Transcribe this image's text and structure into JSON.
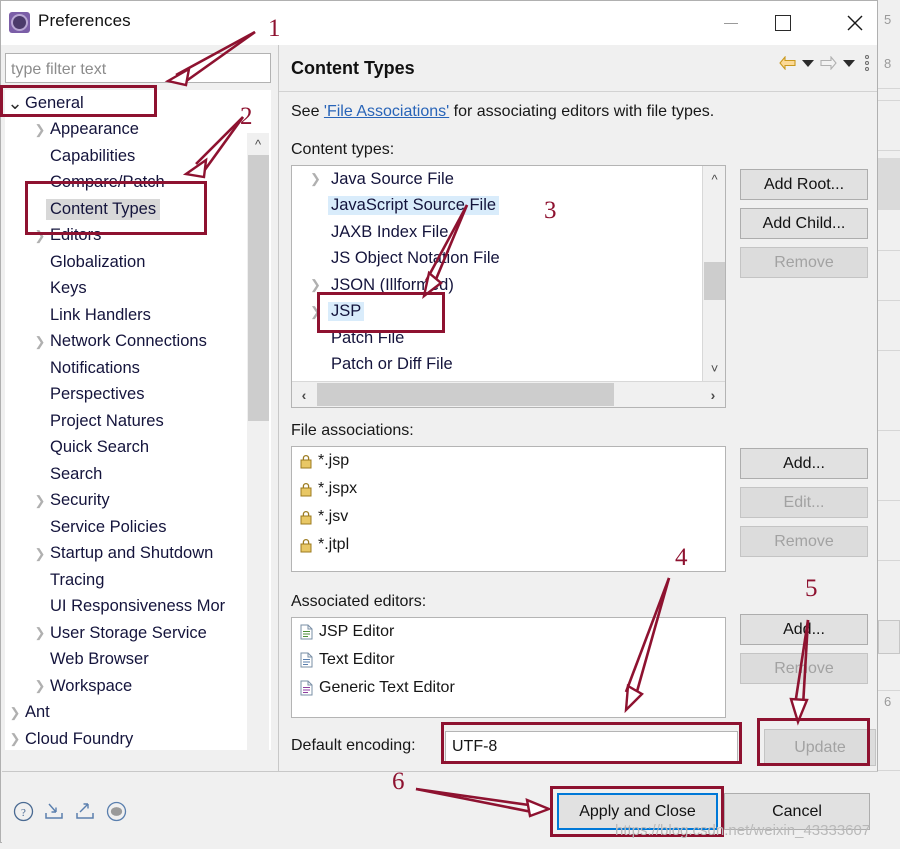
{
  "window": {
    "title": "Preferences",
    "icon": "preferences-gear-icon",
    "controls": {
      "minimize": "—",
      "maximize": "□",
      "close": "✕"
    }
  },
  "sidebar": {
    "filter_placeholder": "type filter text",
    "filter_value": "",
    "items": [
      {
        "label": "General",
        "level": 0,
        "twisty": "down",
        "selected": false
      },
      {
        "label": "Appearance",
        "level": 1,
        "twisty": "right",
        "selected": false
      },
      {
        "label": "Capabilities",
        "level": 1,
        "twisty": "none",
        "selected": false
      },
      {
        "label": "Compare/Patch",
        "level": 1,
        "twisty": "none",
        "selected": false
      },
      {
        "label": "Content Types",
        "level": 1,
        "twisty": "none",
        "selected": true
      },
      {
        "label": "Editors",
        "level": 1,
        "twisty": "right",
        "selected": false
      },
      {
        "label": "Globalization",
        "level": 1,
        "twisty": "none",
        "selected": false
      },
      {
        "label": "Keys",
        "level": 1,
        "twisty": "none",
        "selected": false
      },
      {
        "label": "Link Handlers",
        "level": 1,
        "twisty": "none",
        "selected": false
      },
      {
        "label": "Network Connections",
        "level": 1,
        "twisty": "right",
        "selected": false
      },
      {
        "label": "Notifications",
        "level": 1,
        "twisty": "none",
        "selected": false
      },
      {
        "label": "Perspectives",
        "level": 1,
        "twisty": "none",
        "selected": false
      },
      {
        "label": "Project Natures",
        "level": 1,
        "twisty": "none",
        "selected": false
      },
      {
        "label": "Quick Search",
        "level": 1,
        "twisty": "none",
        "selected": false
      },
      {
        "label": "Search",
        "level": 1,
        "twisty": "none",
        "selected": false
      },
      {
        "label": "Security",
        "level": 1,
        "twisty": "right",
        "selected": false
      },
      {
        "label": "Service Policies",
        "level": 1,
        "twisty": "none",
        "selected": false
      },
      {
        "label": "Startup and Shutdown",
        "level": 1,
        "twisty": "right",
        "selected": false
      },
      {
        "label": "Tracing",
        "level": 1,
        "twisty": "none",
        "selected": false
      },
      {
        "label": "UI Responsiveness Mor",
        "level": 1,
        "twisty": "none",
        "selected": false
      },
      {
        "label": "User Storage Service",
        "level": 1,
        "twisty": "right",
        "selected": false
      },
      {
        "label": "Web Browser",
        "level": 1,
        "twisty": "none",
        "selected": false
      },
      {
        "label": "Workspace",
        "level": 1,
        "twisty": "right",
        "selected": false
      },
      {
        "label": "Ant",
        "level": 0,
        "twisty": "right",
        "selected": false
      },
      {
        "label": "Cloud Foundry",
        "level": 0,
        "twisty": "right",
        "selected": false
      }
    ]
  },
  "page": {
    "title": "Content Types",
    "intro_prefix": "See ",
    "intro_link": "'File Associations'",
    "intro_suffix": " for associating editors with file types.",
    "labels": {
      "content_types": "Content types:",
      "file_associations": "File associations:",
      "associated_editors": "Associated editors:",
      "default_encoding": "Default encoding:"
    },
    "content_types": [
      {
        "label": "Java Source File",
        "twisty": "right",
        "selected": false
      },
      {
        "label": "JavaScript Source File",
        "twisty": "none",
        "selected": true
      },
      {
        "label": "JAXB Index File",
        "twisty": "none",
        "selected": false
      },
      {
        "label": "JS Object Notation File",
        "twisty": "none",
        "selected": false
      },
      {
        "label": "JSON (Illformed)",
        "twisty": "right",
        "selected": false
      },
      {
        "label": "JSP",
        "twisty": "right",
        "selected": true
      },
      {
        "label": "Patch File",
        "twisty": "none",
        "selected": false
      },
      {
        "label": "Patch or Diff File",
        "twisty": "none",
        "selected": false
      }
    ],
    "content_type_buttons": [
      {
        "label": "Add Root...",
        "enabled": true
      },
      {
        "label": "Add Child...",
        "enabled": true
      },
      {
        "label": "Remove",
        "enabled": false
      }
    ],
    "file_associations": [
      {
        "label": "*.jsp",
        "icon": "lock-icon"
      },
      {
        "label": "*.jspx",
        "icon": "lock-icon"
      },
      {
        "label": "*.jsv",
        "icon": "lock-icon"
      },
      {
        "label": "*.jtpl",
        "icon": "lock-icon"
      }
    ],
    "file_association_buttons": [
      {
        "label": "Add...",
        "enabled": true
      },
      {
        "label": "Edit...",
        "enabled": false
      },
      {
        "label": "Remove",
        "enabled": false
      }
    ],
    "associated_editors": [
      {
        "label": "JSP Editor",
        "icon": "jsp-editor-icon"
      },
      {
        "label": "Text Editor",
        "icon": "text-editor-icon"
      },
      {
        "label": "Generic Text Editor",
        "icon": "generic-text-editor-icon"
      }
    ],
    "associated_editor_buttons": [
      {
        "label": "Add...",
        "enabled": true
      },
      {
        "label": "Remove",
        "enabled": false
      }
    ],
    "default_encoding_value": "UTF-8",
    "update_button": {
      "label": "Update",
      "enabled": false
    },
    "nav_icons": [
      "back-arrow-icon",
      "back-dropdown-icon",
      "forward-arrow-icon",
      "forward-dropdown-icon",
      "view-menu-icon"
    ]
  },
  "footer": {
    "icons": [
      "help-icon",
      "import-icon",
      "export-icon",
      "record-icon"
    ],
    "apply_label": "Apply and Close",
    "cancel_label": "Cancel"
  },
  "annotations": {
    "numbers": [
      "1",
      "2",
      "3",
      "4",
      "5",
      "6"
    ],
    "color": "#8e1230"
  },
  "watermark": "https://blog.csdn.net/weixin_43333607",
  "background_window": {
    "labels": [
      "5",
      "8",
      "6"
    ]
  }
}
